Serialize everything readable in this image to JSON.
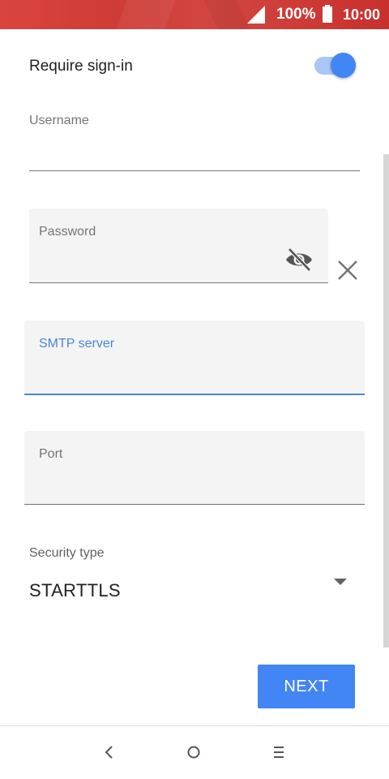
{
  "status_bar": {
    "battery": "100%",
    "time": "10:00",
    "icons": [
      "signal-icon",
      "battery-icon"
    ],
    "color": "#d24641"
  },
  "sign_in": {
    "label": "Require sign-in",
    "enabled": true
  },
  "fields": {
    "username": {
      "label": "Username",
      "value": ""
    },
    "password": {
      "label": "Password",
      "value": ""
    },
    "smtp_server": {
      "label": "SMTP server",
      "value": "",
      "focused": true
    },
    "port": {
      "label": "Port",
      "value": ""
    }
  },
  "security": {
    "label": "Security type",
    "selected": "STARTTLS"
  },
  "next_button": {
    "label": "NEXT"
  },
  "navigation": {
    "icons": [
      "back-icon",
      "home-icon",
      "menu-icon"
    ]
  },
  "colors": {
    "accent": "#4285f4",
    "focus": "#4a86d6",
    "status_bar": "#d24641"
  }
}
